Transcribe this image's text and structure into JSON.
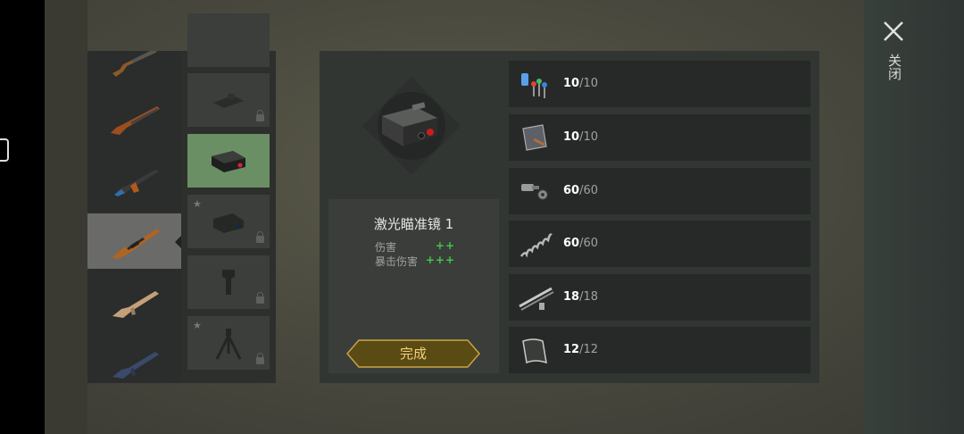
{
  "item": {
    "title": "激光瞄准镜 1",
    "stats": [
      {
        "label": "伤害",
        "value": "++"
      },
      {
        "label": "暴击伤害",
        "value": "+++"
      }
    ]
  },
  "done_button": "完成",
  "close_label": "关闭",
  "weapons": [
    {
      "name": "shotgun-icon"
    },
    {
      "name": "double-barrel-shotgun-icon"
    },
    {
      "name": "ak-rifle-icon"
    },
    {
      "name": "dragunov-rifle-icon",
      "selected": true
    },
    {
      "name": "scar-rifle-icon"
    },
    {
      "name": "m4-rifle-icon"
    }
  ],
  "attachments": [
    {
      "name": "attachment-slot-top-icon",
      "locked": false
    },
    {
      "name": "scope-rail-icon",
      "locked": true
    },
    {
      "name": "laser-sight-icon",
      "locked": false,
      "active": true
    },
    {
      "name": "night-scope-icon",
      "locked": true,
      "starred": true
    },
    {
      "name": "grip-icon",
      "locked": true
    },
    {
      "name": "bipod-icon",
      "locked": true,
      "starred": true
    }
  ],
  "materials": [
    {
      "name": "electronic-parts-icon",
      "have": "10",
      "need": "10"
    },
    {
      "name": "metal-plate-icon",
      "have": "10",
      "need": "10"
    },
    {
      "name": "bolts-nuts-icon",
      "have": "60",
      "need": "60"
    },
    {
      "name": "spring-icon",
      "have": "60",
      "need": "60"
    },
    {
      "name": "pipes-icon",
      "have": "18",
      "need": "18"
    },
    {
      "name": "sheet-metal-icon",
      "have": "12",
      "need": "12"
    }
  ],
  "colors": {
    "accent_gold": "#f2d17a",
    "stat_green": "#49c24b",
    "active_slot": "#6b8f64"
  }
}
